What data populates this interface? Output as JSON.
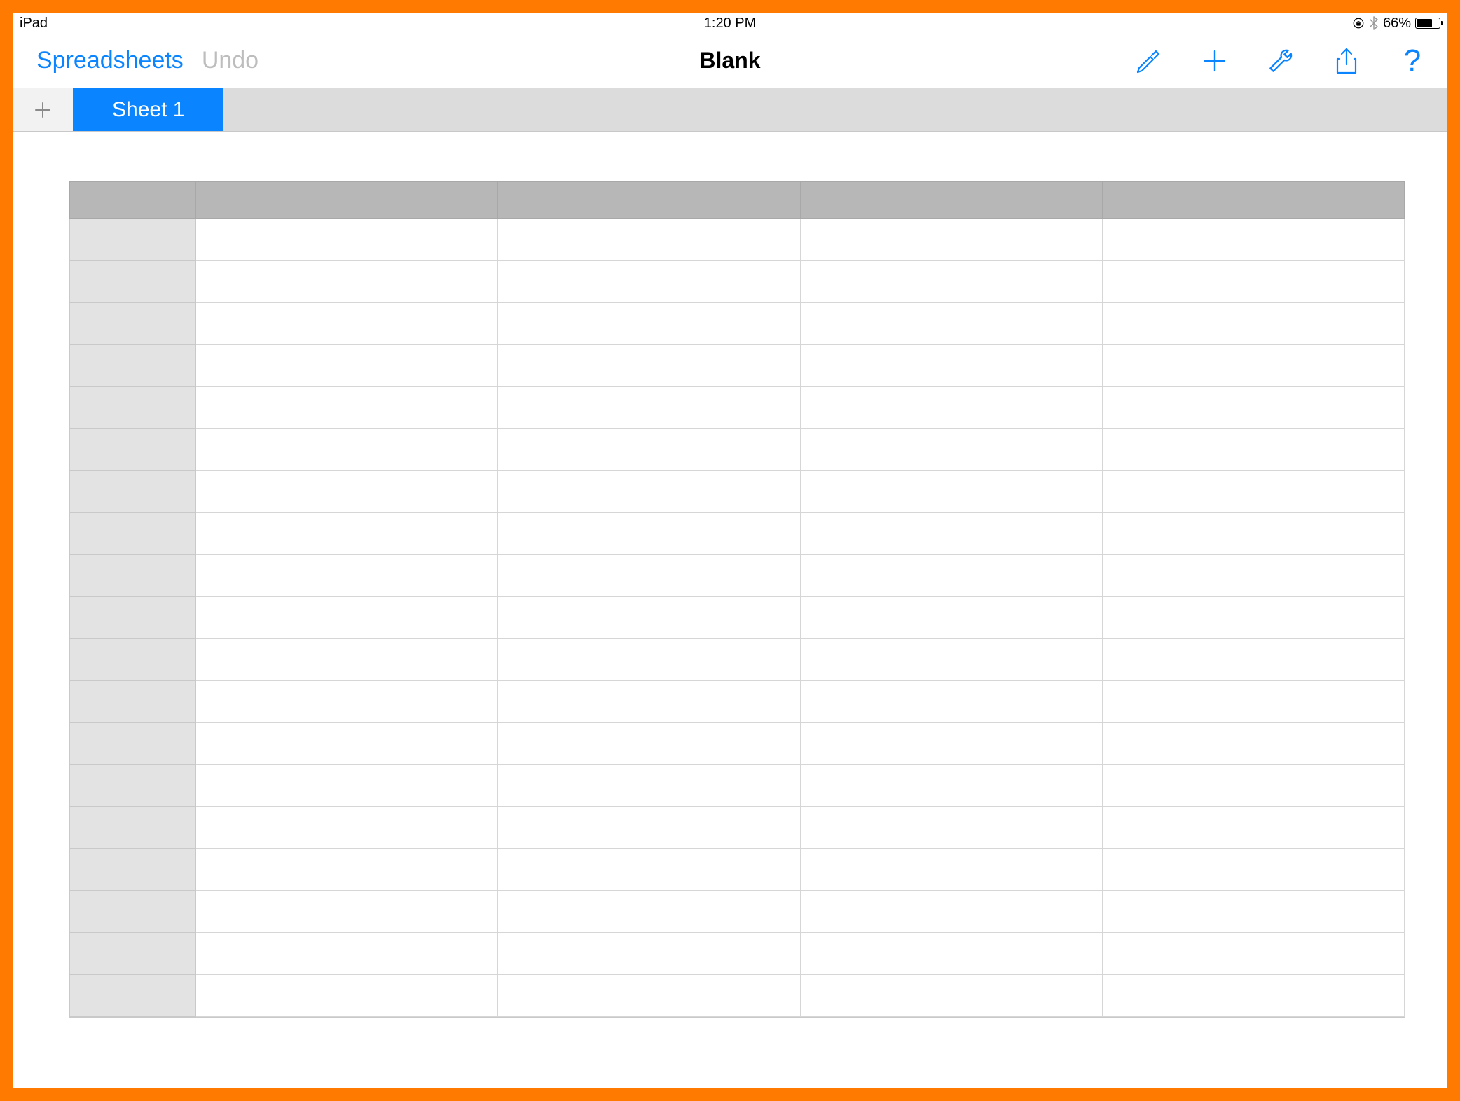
{
  "status": {
    "device": "iPad",
    "time": "1:20 PM",
    "battery_percent": "66%"
  },
  "toolbar": {
    "back_label": "Spreadsheets",
    "undo_label": "Undo",
    "title": "Blank",
    "icons": {
      "format": "format-brush-icon",
      "add": "add-icon",
      "tools": "wrench-icon",
      "share": "share-icon",
      "help": "help-icon"
    }
  },
  "tabs": {
    "add_label": "+",
    "active": "Sheet 1"
  },
  "grid": {
    "columns": 9,
    "rows": 19,
    "column_headers": [
      "",
      "",
      "",
      "",
      "",
      "",
      "",
      "",
      ""
    ],
    "row_headers": [
      "",
      "",
      "",
      "",
      "",
      "",
      "",
      "",
      "",
      "",
      "",
      "",
      "",
      "",
      "",
      "",
      "",
      "",
      ""
    ],
    "cells": []
  },
  "colors": {
    "accent": "#0a84ff",
    "frame": "#ff7a00",
    "tab_bar": "#dcdcdc",
    "header_cell": "#b7b7b7",
    "row_header": "#e3e3e3"
  }
}
